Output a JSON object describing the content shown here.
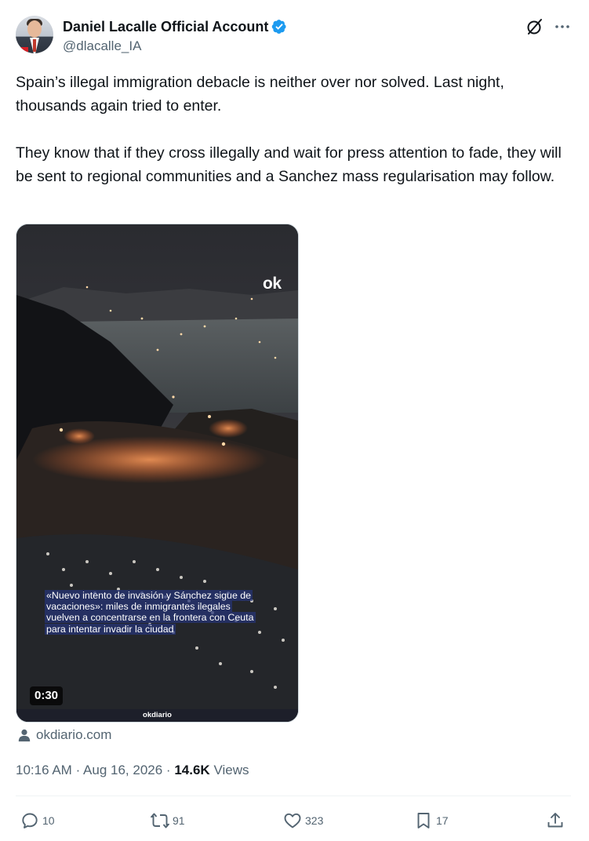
{
  "author": {
    "name": "Daniel Lacalle Official Account",
    "handle": "@dlacalle_IA",
    "verified_color": "#1d9bf0"
  },
  "tweet": {
    "paragraphs": [
      "Spain’s illegal immigration debacle is neither over nor solved. Last night, thousands again tried to enter.",
      "They know that if they cross illegally and wait for press attention to fade, they will be sent to regional communities and a Sanchez mass regularisation may follow."
    ]
  },
  "media": {
    "logo": "ok",
    "caption": "«Nuevo intento de invasión y Sánchez sigue de vacaciones»: miles de inmigrantes ilegales vuelven a concentrarse en la frontera con Ceuta para intentar invadir la ciudad",
    "duration": "0:30",
    "source": "okdiario"
  },
  "link": {
    "icon": "person-icon",
    "domain": "okdiario.com"
  },
  "meta": {
    "time": "10:16 AM",
    "date": "Aug 16, 2026",
    "separator": "·",
    "views_count": "14.6K",
    "views_label": "Views"
  },
  "actions": {
    "replies": "10",
    "reposts": "91",
    "likes": "323",
    "bookmarks": "17"
  },
  "icons": {
    "grok": "grok-icon",
    "more": "more-icon",
    "reply": "reply-icon",
    "repost": "repost-icon",
    "like": "like-icon",
    "bookmark": "bookmark-icon",
    "share": "share-icon"
  }
}
